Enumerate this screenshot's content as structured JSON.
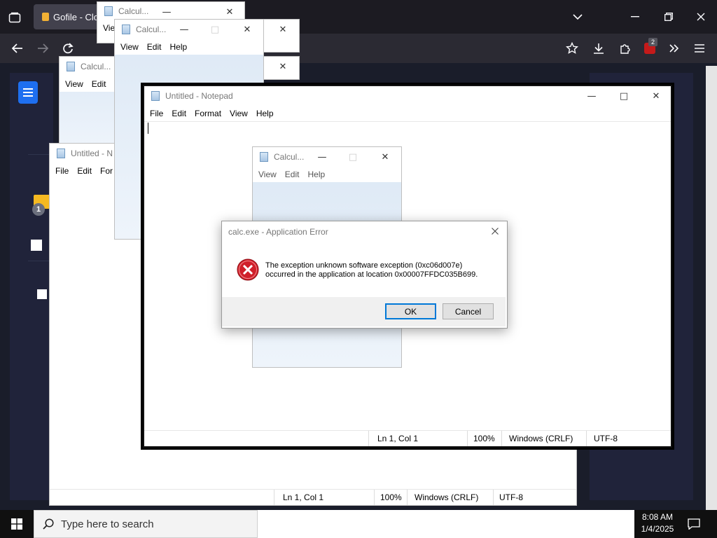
{
  "browser": {
    "tab_title": "Gofile - Clo",
    "notification_badge": "2"
  },
  "page": {
    "badge_count": "1"
  },
  "calculator_windows": [
    {
      "title": "Calcul...",
      "menu": [
        "View",
        "Edit",
        "Help"
      ]
    },
    {
      "title": "Calcul...",
      "menu": [
        "View",
        "Edit",
        "Help"
      ]
    },
    {
      "title": "Calcul...",
      "menu": [
        "View",
        "Edit"
      ]
    },
    {
      "title": "Calcul...",
      "menu": [
        "View",
        "Edit",
        "Help"
      ]
    },
    {
      "title": "",
      "menu": [
        "Vie"
      ]
    }
  ],
  "notepad_back": {
    "title": "Untitled - N",
    "menu": [
      "File",
      "Edit",
      "For"
    ],
    "status": {
      "position": "Ln 1, Col 1",
      "zoom": "100%",
      "line_ending": "Windows (CRLF)",
      "encoding": "UTF-8"
    }
  },
  "notepad_front": {
    "title": "Untitled - Notepad",
    "menu": [
      "File",
      "Edit",
      "Format",
      "View",
      "Help"
    ],
    "status": {
      "position": "Ln 1, Col 1",
      "zoom": "100%",
      "line_ending": "Windows (CRLF)",
      "encoding": "UTF-8"
    }
  },
  "error_dialog": {
    "title": "calc.exe - Application Error",
    "message_line1": "The exception unknown software exception (0xc06d007e)",
    "message_line2": "occurred in the application at location 0x00007FFDC035B699.",
    "ok_label": "OK",
    "cancel_label": "Cancel"
  },
  "taskbar": {
    "search_placeholder": "Type here to search",
    "time": "8:08 AM",
    "date": "1/4/2025"
  },
  "colors": {
    "browser_bg": "#1c1b22",
    "toolbar_bg": "#2b2a33",
    "accent_blue": "#1e6ff0",
    "error_red": "#d0202a"
  }
}
